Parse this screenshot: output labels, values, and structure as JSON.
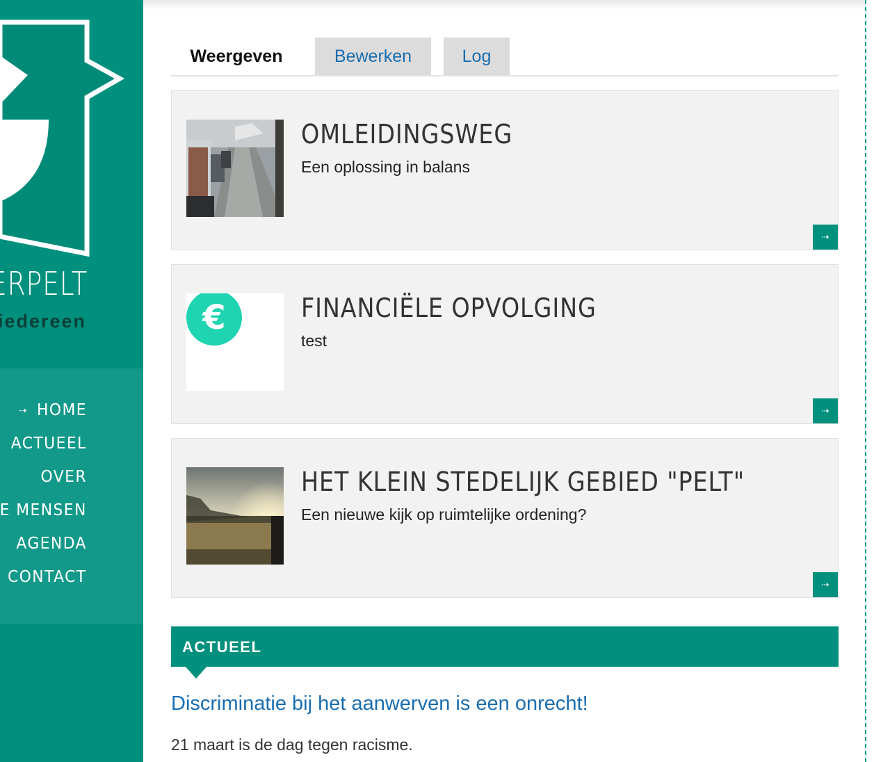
{
  "sidebar": {
    "brand_name": "ERPELT",
    "brand_tagline": "iedereen",
    "nav": [
      {
        "label": "HOME",
        "active": true
      },
      {
        "label": "ACTUEEL"
      },
      {
        "label": "OVER"
      },
      {
        "label": "E MENSEN"
      },
      {
        "label": "AGENDA"
      },
      {
        "label": "CONTACT"
      }
    ]
  },
  "tabs": [
    {
      "label": "Weergeven",
      "active": true
    },
    {
      "label": "Bewerken"
    },
    {
      "label": "Log"
    }
  ],
  "cards": [
    {
      "title": "OMLEIDINGSWEG",
      "subtitle": "Een oplossing in balans",
      "image": "street-traffic-photo"
    },
    {
      "title": "FINANCIËLE OPVOLGING",
      "subtitle": "test",
      "image": "euro-icon"
    },
    {
      "title": "HET KLEIN STEDELIJK GEBIED \"PELT\"",
      "subtitle": "Een nieuwe kijk op ruimtelijke ordening?",
      "image": "canal-sunset-photo"
    }
  ],
  "actueel": {
    "heading": "ACTUEEL",
    "news_title": "Discriminatie bij het aanwerven is een onrecht!",
    "news_text": "21 maart is de dag tegen racisme."
  },
  "colors": {
    "brand": "#00907d",
    "link": "#1a6eb0",
    "card_bg": "#f2f2f2"
  }
}
